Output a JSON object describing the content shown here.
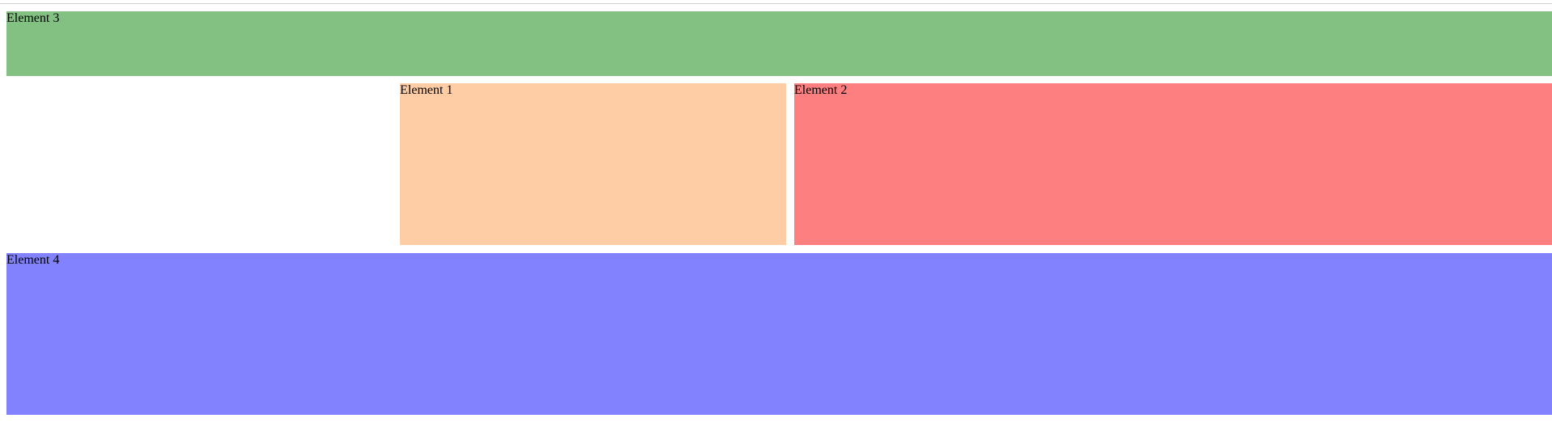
{
  "elements": {
    "element3": {
      "label": "Element 3",
      "color": "#82c182"
    },
    "element1": {
      "label": "Element 1",
      "color": "#fecda6"
    },
    "element2": {
      "label": "Element 2",
      "color": "#fe7f7f"
    },
    "element4": {
      "label": "Element 4",
      "color": "#8282fe"
    }
  }
}
